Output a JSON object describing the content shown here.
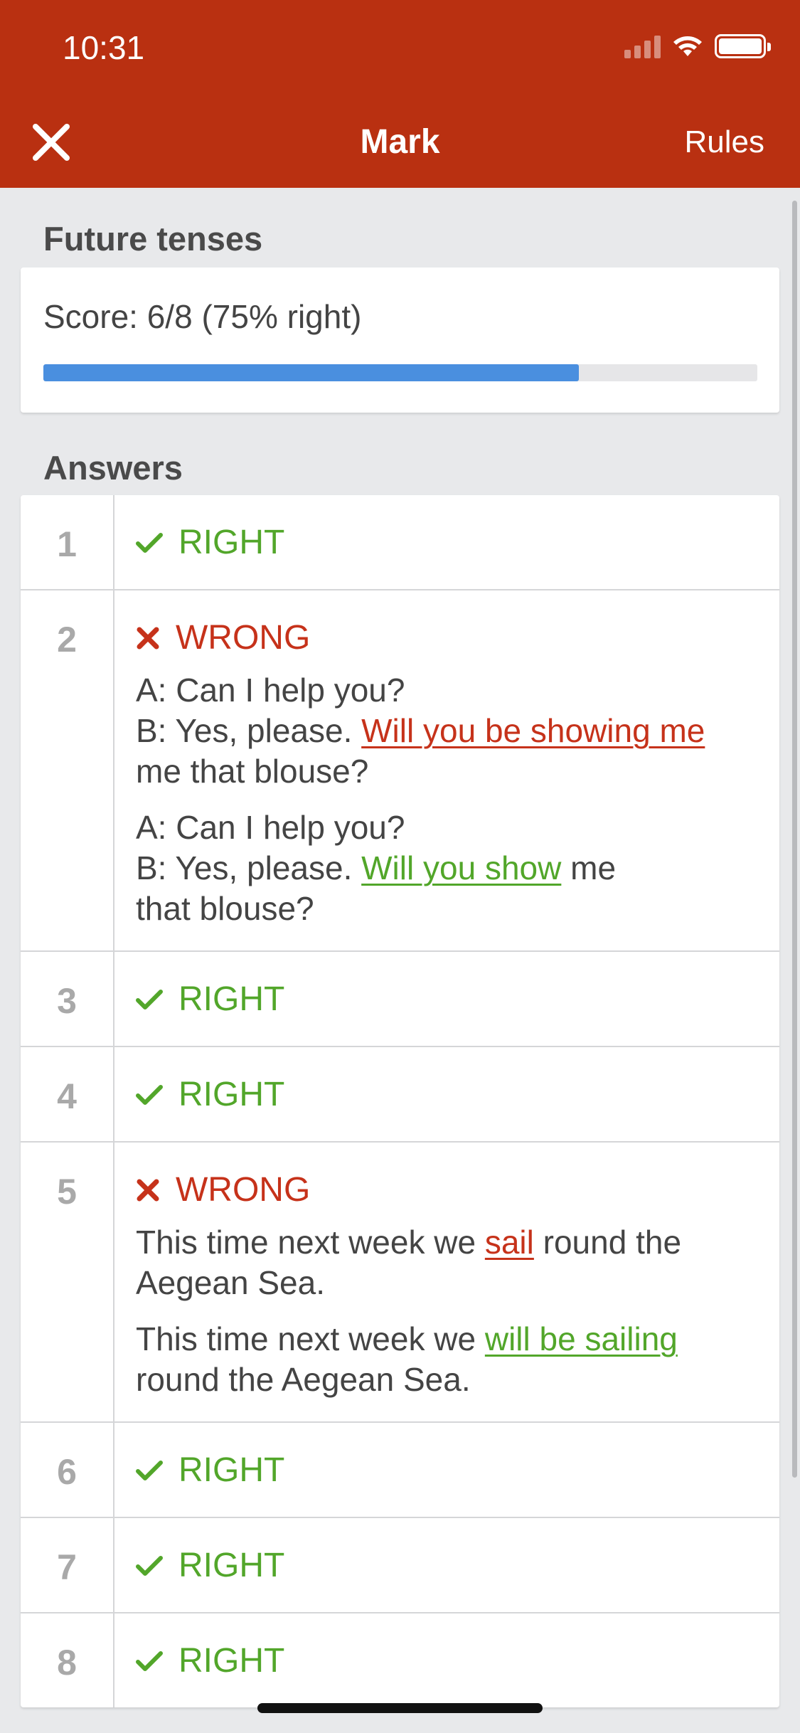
{
  "status_bar": {
    "time": "10:31"
  },
  "nav": {
    "title": "Mark",
    "rules_label": "Rules"
  },
  "quiz": {
    "title": "Future tenses",
    "score_text": "Score: 6/8 (75% right)",
    "progress_fraction": 0.75
  },
  "answers_section": {
    "title": "Answers"
  },
  "colors": {
    "header": "#b93011",
    "right": "#52a62a",
    "wrong": "#c6321a",
    "progress": "#4a8fdf"
  },
  "answers": [
    {
      "num": "1",
      "verdict": "RIGHT"
    },
    {
      "num": "2",
      "verdict": "WRONG",
      "given": {
        "l1": "A: Can I help you?",
        "l2_pre": "B: Yes, please. ",
        "hl": "Will you be showing me",
        "post": "me that blouse?"
      },
      "correct": {
        "l1": "A: Can I help you?",
        "l2_pre": "B: Yes, please. ",
        "hl": "Will you show",
        "l2_post": " me",
        "l3": "that blouse?"
      }
    },
    {
      "num": "3",
      "verdict": "RIGHT"
    },
    {
      "num": "4",
      "verdict": "RIGHT"
    },
    {
      "num": "5",
      "verdict": "WRONG",
      "given": {
        "pre": "This time next week we ",
        "hl": "sail",
        "post": " round the Aegean Sea."
      },
      "correct": {
        "pre": "This time next week we ",
        "hl": "will be sailing",
        "post": "round the Aegean Sea."
      }
    },
    {
      "num": "6",
      "verdict": "RIGHT"
    },
    {
      "num": "7",
      "verdict": "RIGHT"
    },
    {
      "num": "8",
      "verdict": "RIGHT"
    }
  ]
}
